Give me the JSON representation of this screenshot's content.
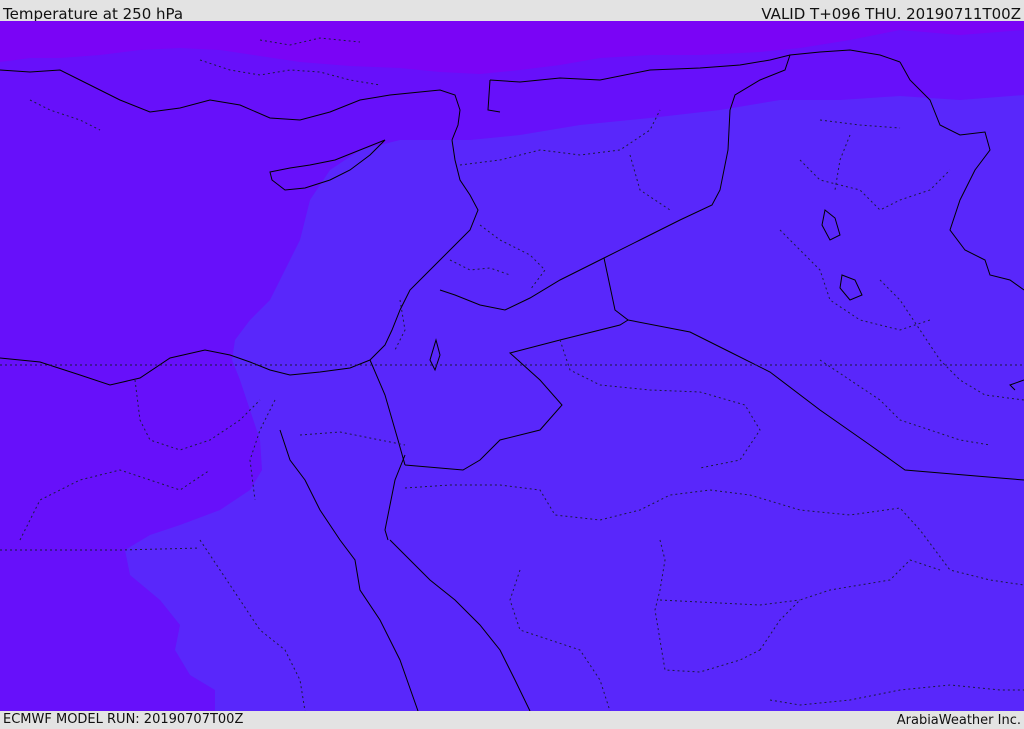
{
  "header": {
    "title": "Temperature at 250 hPa",
    "valid": "VALID T+096 THU. 20190711T00Z"
  },
  "footer": {
    "run": "ECMWF MODEL RUN: 20190707T00Z",
    "credit": "ArabiaWeather Inc."
  },
  "colors": {
    "band_warm": "#5927fb",
    "band_mid": "#6710fa",
    "band_cold": "#7a04f6",
    "coastline": "#000000",
    "border": "#1a1a40"
  }
}
